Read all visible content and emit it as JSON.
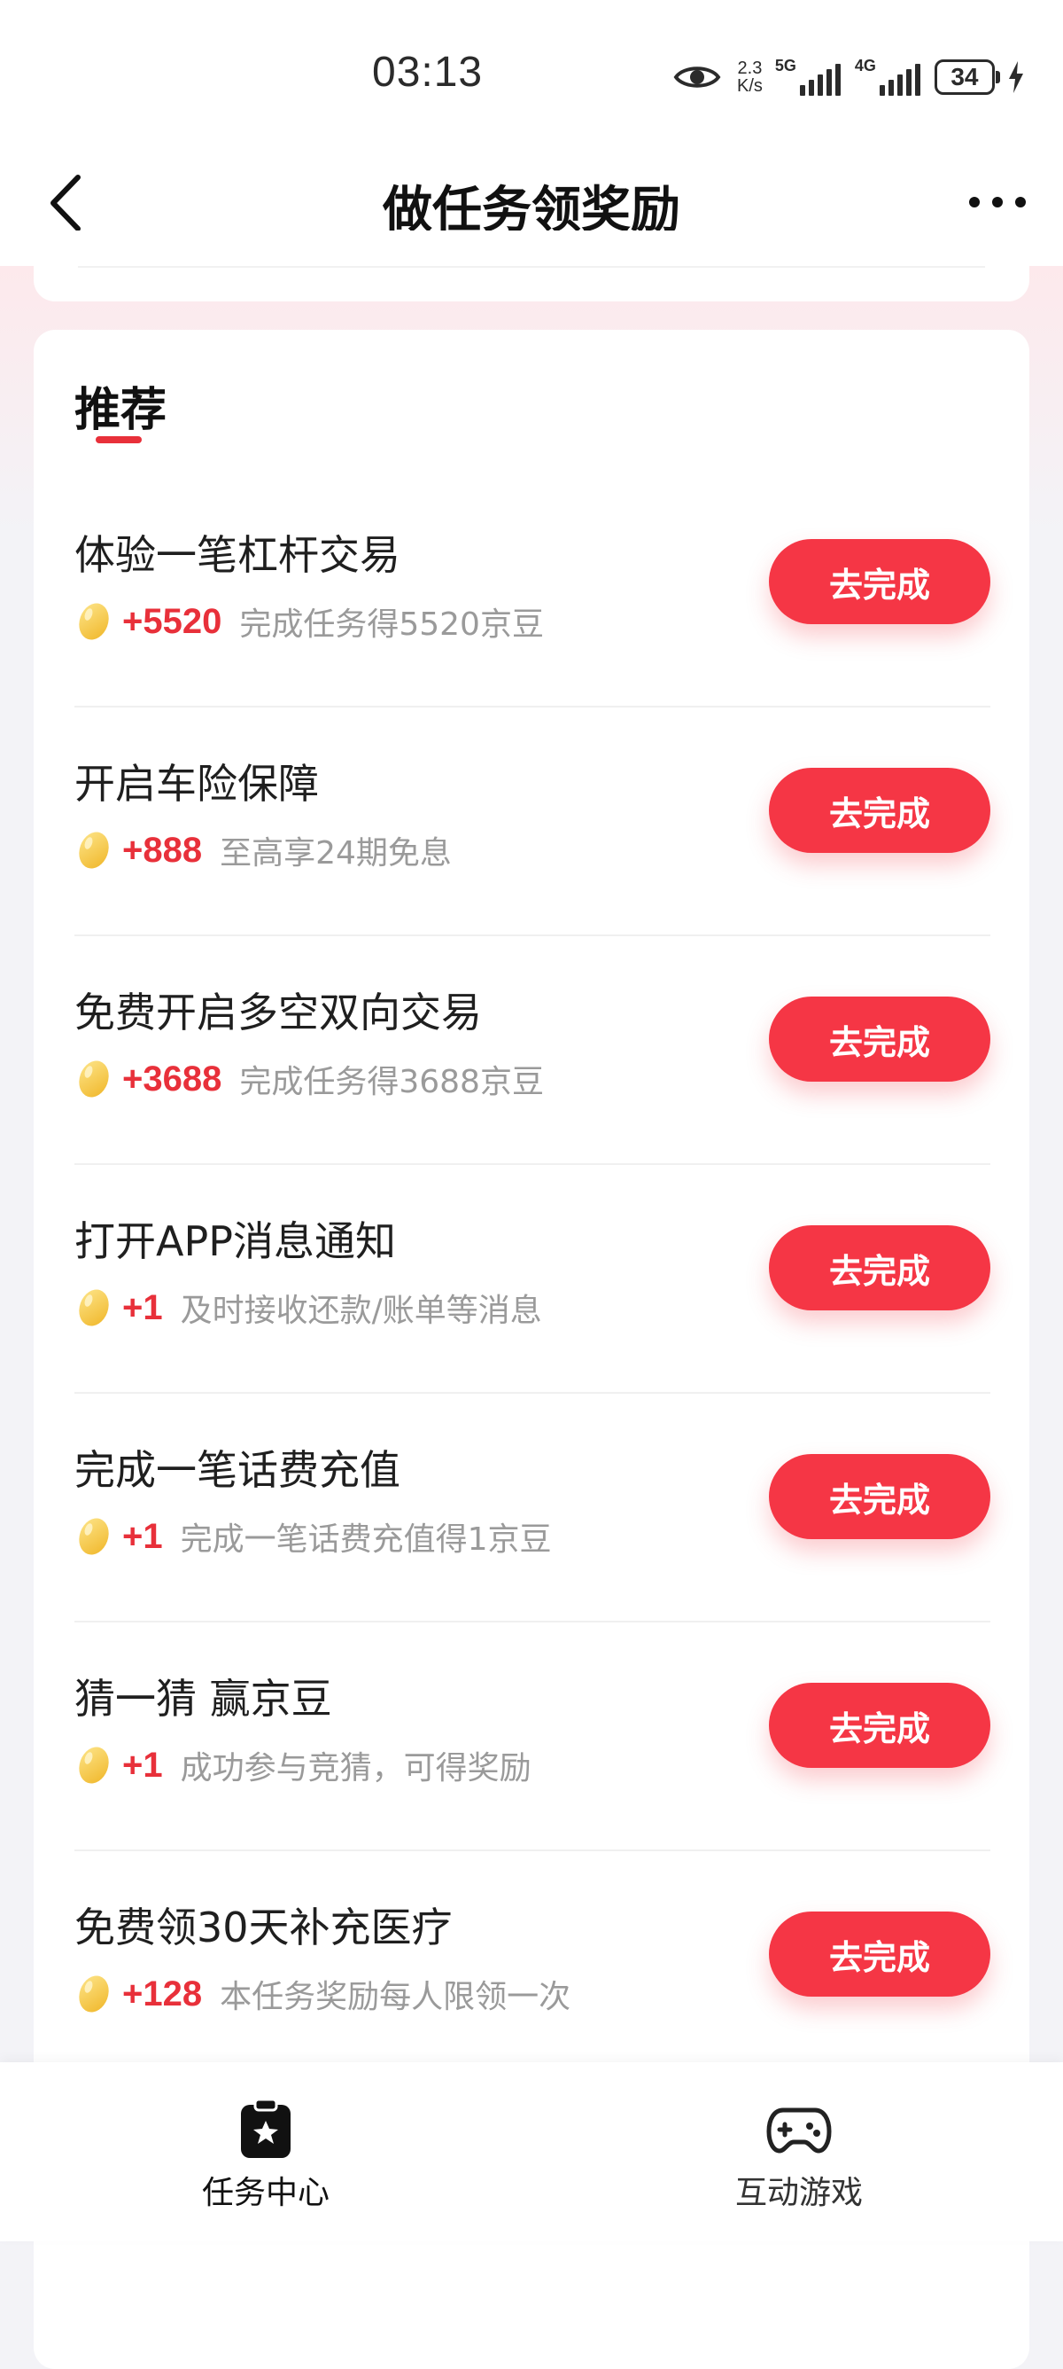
{
  "status_bar": {
    "time": "03:13",
    "net_speed_value": "2.3",
    "net_speed_unit": "K/s",
    "signal1_label": "5G",
    "signal2_label": "4G",
    "battery": "34"
  },
  "header": {
    "title": "做任务领奖励"
  },
  "section": {
    "title": "推荐"
  },
  "tasks": [
    {
      "title": "体验一笔杠杆交易",
      "reward": "+5520",
      "desc": "完成任务得5520京豆",
      "button": "去完成"
    },
    {
      "title": "开启车险保障",
      "reward": "+888",
      "desc": "至高享24期免息",
      "button": "去完成"
    },
    {
      "title": "免费开启多空双向交易",
      "reward": "+3688",
      "desc": "完成任务得3688京豆",
      "button": "去完成"
    },
    {
      "title": "打开APP消息通知",
      "reward": "+1",
      "desc": "及时接收还款/账单等消息",
      "button": "去完成"
    },
    {
      "title": "完成一笔话费充值",
      "reward": "+1",
      "desc": "完成一笔话费充值得1京豆",
      "button": "去完成"
    },
    {
      "title": "猜一猜 赢京豆",
      "reward": "+1",
      "desc": "成功参与竞猜，可得奖励",
      "button": "去完成"
    },
    {
      "title": "免费领30天补充医疗",
      "reward": "+128",
      "desc": "本任务奖励每人限领一次",
      "button": "去完成"
    }
  ],
  "tab_bar": {
    "tabs": [
      {
        "label": "任务中心",
        "icon": "task-center-icon",
        "active": true
      },
      {
        "label": "互动游戏",
        "icon": "gamepad-icon",
        "active": false
      }
    ]
  },
  "colors": {
    "accent": "#f53645",
    "reward": "#e8303a",
    "muted": "#9a9a9a",
    "bean": "#f5c842"
  }
}
